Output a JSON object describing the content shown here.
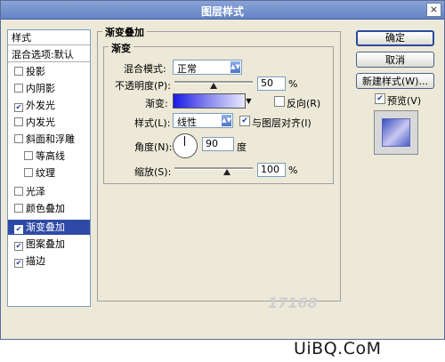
{
  "window": {
    "title": "图层样式",
    "close_label": "×"
  },
  "sidebar": {
    "header": "样式",
    "items": [
      {
        "label": "混合选项:默认",
        "checkbox": false,
        "checked": false,
        "selected": false
      },
      {
        "label": "投影",
        "checkbox": true,
        "checked": false,
        "selected": false
      },
      {
        "label": "内阴影",
        "checkbox": true,
        "checked": false,
        "selected": false
      },
      {
        "label": "外发光",
        "checkbox": true,
        "checked": true,
        "selected": false
      },
      {
        "label": "内发光",
        "checkbox": true,
        "checked": false,
        "selected": false
      },
      {
        "label": "斜面和浮雕",
        "checkbox": true,
        "checked": false,
        "selected": false
      },
      {
        "label": "等高线",
        "checkbox": true,
        "checked": false,
        "selected": false,
        "sub": true
      },
      {
        "label": "纹理",
        "checkbox": true,
        "checked": false,
        "selected": false,
        "sub": true
      },
      {
        "label": "光泽",
        "checkbox": true,
        "checked": false,
        "selected": false
      },
      {
        "label": "颜色叠加",
        "checkbox": true,
        "checked": false,
        "selected": false
      },
      {
        "label": "渐变叠加",
        "checkbox": true,
        "checked": true,
        "selected": true
      },
      {
        "label": "图案叠加",
        "checkbox": true,
        "checked": true,
        "selected": false
      },
      {
        "label": "描边",
        "checkbox": true,
        "checked": true,
        "selected": false
      }
    ]
  },
  "panel": {
    "group_title": "渐变叠加",
    "subgroup_title": "渐变",
    "blend_mode": {
      "label": "混合模式:",
      "value": "正常"
    },
    "opacity": {
      "label": "不透明度(P):",
      "value": "50",
      "unit": "%",
      "level": 0.5
    },
    "gradient": {
      "label": "渐变:",
      "reverse_label": "反向(R)",
      "reverse_checked": false,
      "colors": [
        "#1a1ae6",
        "#8a8af0",
        "#e8e8ff"
      ]
    },
    "style": {
      "label": "样式(L):",
      "value": "线性",
      "align_label": "与图层对齐(I)",
      "align_checked": true
    },
    "angle": {
      "label": "角度(N):",
      "value": "90",
      "unit": "度"
    },
    "scale": {
      "label": "缩放(S):",
      "value": "100",
      "unit": "%",
      "level": 0.67
    }
  },
  "buttons": {
    "ok": "确定",
    "cancel": "取消",
    "new_style": "新建样式(W)...",
    "preview_label": "预览(V)",
    "preview_checked": true
  },
  "watermark": {
    "site": "UiBQ.CoM",
    "faint": "17168"
  },
  "icons": {
    "checkmark": "✔",
    "dropdown": "▲▼",
    "gradient_dropdown": "▼"
  },
  "colors": {
    "selection": "#2f4aa6",
    "accent": "#2a49a0"
  }
}
